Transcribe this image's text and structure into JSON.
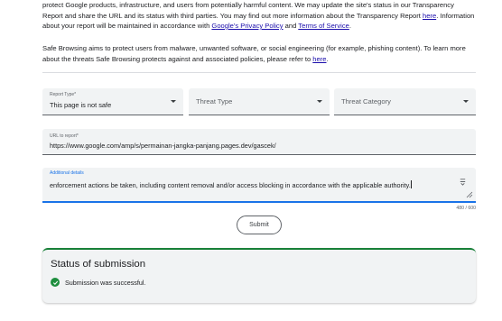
{
  "intro": {
    "line1": "protect Google products, infrastructure, and users from potentially harmful content. We may update the site's status in our Transparency Report and share the URL and its status with third parties. You may find out more information about the Transparency Report ",
    "here_link": "here",
    "line1_cont": ". Information about your report will be maintained in accordance with ",
    "privacy_link": "Google's Privacy Policy",
    "and": " and ",
    "terms_link": "Terms of Service",
    "end": "."
  },
  "safe_browsing": {
    "text": "Safe Browsing aims to protect users from malware, unwanted software, or social engineering (for example, phishing content). To learn more about the threats Safe Browsing protects against and associated policies, please refer to ",
    "here_link": "here",
    "end": "."
  },
  "report_type": {
    "label": "Report Type*",
    "value": "This page is not safe"
  },
  "threat_type": {
    "placeholder": "Threat Type"
  },
  "threat_category": {
    "placeholder": "Threat Category"
  },
  "url_field": {
    "label": "URL to report*",
    "value": "https://www.google.com/amp/s/permainan-jangka-panjang.pages.dev/gascek/"
  },
  "details_field": {
    "label": "Additional details",
    "value": "enforcement actions be taken, including content removal and/or access blocking in accordance with the applicable authority."
  },
  "counter": "480 / 600",
  "submit_label": "Submit",
  "status": {
    "title": "Status of submission",
    "message": "Submission was successful."
  },
  "colors": {
    "link": "#1a0dab",
    "focus": "#1a73e8",
    "success": "#1e8e3e"
  }
}
